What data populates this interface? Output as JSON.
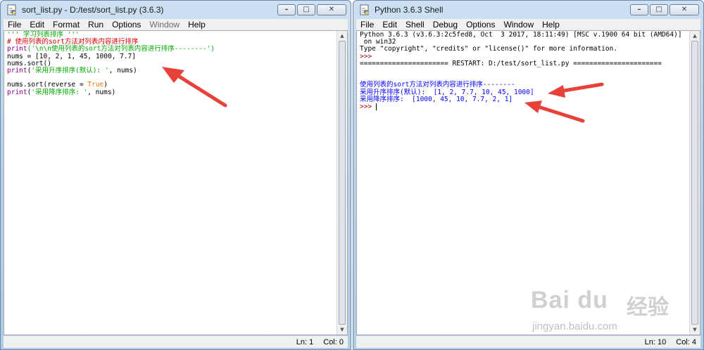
{
  "left_window": {
    "title": "sort_list.py - D:/test/sort_list.py (3.6.3)",
    "menu": [
      {
        "label": "File",
        "enabled": true
      },
      {
        "label": "Edit",
        "enabled": true
      },
      {
        "label": "Format",
        "enabled": true
      },
      {
        "label": "Run",
        "enabled": true
      },
      {
        "label": "Options",
        "enabled": true
      },
      {
        "label": "Window",
        "enabled": false
      },
      {
        "label": "Help",
        "enabled": true
      }
    ],
    "code": [
      [
        {
          "t": "''' 学习列表排序 '''",
          "c": "str"
        }
      ],
      [
        {
          "t": "# 使用列表的sort方法对列表内容进行排序",
          "c": "cmt"
        }
      ],
      [
        {
          "t": "print",
          "c": "bi"
        },
        {
          "t": "('\\n\\n使用列表的sort方法对列表内容进行排序--------')",
          "c": "str"
        }
      ],
      [
        {
          "t": "nums = [10, 2, 1, 45, 1000, 7.7]",
          "c": "def"
        }
      ],
      [
        {
          "t": "nums.sort()",
          "c": "def"
        }
      ],
      [
        {
          "t": "print",
          "c": "bi"
        },
        {
          "t": "(",
          "c": "def"
        },
        {
          "t": "'采用升序排序(默认): '",
          "c": "str"
        },
        {
          "t": ", nums)",
          "c": "def"
        }
      ],
      [
        {
          "t": "",
          "c": "def"
        }
      ],
      [
        {
          "t": "nums.sort(reverse = ",
          "c": "def"
        },
        {
          "t": "True",
          "c": "kw"
        },
        {
          "t": ")",
          "c": "def"
        }
      ],
      [
        {
          "t": "print",
          "c": "bi"
        },
        {
          "t": "(",
          "c": "def"
        },
        {
          "t": "'采用降序排序: '",
          "c": "str"
        },
        {
          "t": ", nums)",
          "c": "def"
        }
      ]
    ],
    "status": {
      "ln": "Ln: 1",
      "col": "Col: 0"
    }
  },
  "right_window": {
    "title": "Python 3.6.3 Shell",
    "menu": [
      {
        "label": "File",
        "enabled": true
      },
      {
        "label": "Edit",
        "enabled": true
      },
      {
        "label": "Shell",
        "enabled": true
      },
      {
        "label": "Debug",
        "enabled": true
      },
      {
        "label": "Options",
        "enabled": true
      },
      {
        "label": "Window",
        "enabled": true
      },
      {
        "label": "Help",
        "enabled": true
      }
    ],
    "code": [
      [
        {
          "t": "Python 3.6.3 (v3.6.3:2c5fed8, Oct  3 2017, 18:11:49) [MSC v.1900 64 bit (AMD64)]",
          "c": "def"
        }
      ],
      [
        {
          "t": " on win32",
          "c": "def"
        }
      ],
      [
        {
          "t": "Type \"copyright\", \"credits\" or \"license()\" for more information.",
          "c": "def"
        }
      ],
      [
        {
          "t": ">>> ",
          "c": "prompt"
        }
      ],
      [
        {
          "t": "====================== RESTART: D:/test/sort_list.py ======================",
          "c": "def"
        }
      ],
      [
        {
          "t": "",
          "c": "def"
        }
      ],
      [
        {
          "t": "",
          "c": "def"
        }
      ],
      [
        {
          "t": "使用列表的sort方法对列表内容进行排序--------",
          "c": "out"
        }
      ],
      [
        {
          "t": "采用升序排序(默认):  [1, 2, 7.7, 10, 45, 1000]",
          "c": "out"
        }
      ],
      [
        {
          "t": "采用降序排序:  [1000, 45, 10, 7.7, 2, 1]",
          "c": "out"
        }
      ],
      [
        {
          "t": ">>> ",
          "c": "prompt"
        },
        {
          "t": "",
          "c": "cursor"
        }
      ]
    ],
    "status": {
      "ln": "Ln: 10",
      "col": "Col: 4"
    }
  },
  "watermark": {
    "logo": "Bai du",
    "cn": "经验",
    "url": "jingyan.baidu.com"
  },
  "colors": {
    "string": "#00aa00",
    "comment": "#dd0000",
    "keyword": "#ff7700",
    "builtin": "#900090",
    "output": "#0000ff",
    "annotation_arrow": "#e8413a"
  }
}
